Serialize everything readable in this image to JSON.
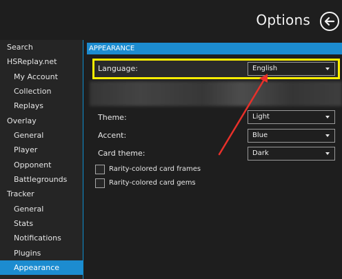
{
  "header": {
    "title": "Options"
  },
  "sidebar": {
    "items": [
      {
        "label": "Search",
        "level": 0,
        "active": false
      },
      {
        "label": "HSReplay.net",
        "level": 0,
        "active": false
      },
      {
        "label": "My Account",
        "level": 1,
        "active": false
      },
      {
        "label": "Collection",
        "level": 1,
        "active": false
      },
      {
        "label": "Replays",
        "level": 1,
        "active": false
      },
      {
        "label": "Overlay",
        "level": 0,
        "active": false
      },
      {
        "label": "General",
        "level": 1,
        "active": false
      },
      {
        "label": "Player",
        "level": 1,
        "active": false
      },
      {
        "label": "Opponent",
        "level": 1,
        "active": false
      },
      {
        "label": "Battlegrounds",
        "level": 1,
        "active": false
      },
      {
        "label": "Tracker",
        "level": 0,
        "active": false
      },
      {
        "label": "General",
        "level": 1,
        "active": false
      },
      {
        "label": "Stats",
        "level": 1,
        "active": false
      },
      {
        "label": "Notifications",
        "level": 1,
        "active": false
      },
      {
        "label": "Plugins",
        "level": 1,
        "active": false
      },
      {
        "label": "Appearance",
        "level": 1,
        "active": true
      }
    ]
  },
  "appearance": {
    "section_title": "APPEARANCE",
    "language": {
      "label": "Language:",
      "value": "English"
    },
    "theme": {
      "label": "Theme:",
      "value": "Light"
    },
    "accent": {
      "label": "Accent:",
      "value": "Blue"
    },
    "card_theme": {
      "label": "Card theme:",
      "value": "Dark"
    },
    "checkboxes": [
      {
        "label": "Rarity-colored card frames",
        "checked": false
      },
      {
        "label": "Rarity-colored card gems",
        "checked": false
      }
    ]
  },
  "colors": {
    "accent": "#1c8cd0",
    "highlight": "#fff000",
    "annotation_arrow": "#e8302a",
    "background": "#1e1e1e"
  }
}
